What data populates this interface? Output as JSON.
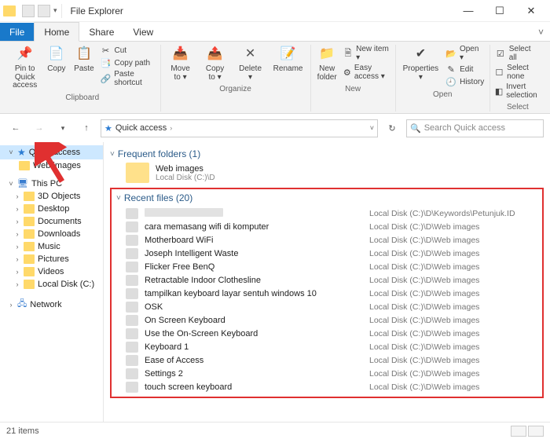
{
  "window": {
    "title": "File Explorer",
    "tabs": {
      "file": "File",
      "home": "Home",
      "share": "Share",
      "view": "View"
    }
  },
  "ribbon": {
    "pin": "Pin to Quick\naccess",
    "copy": "Copy",
    "paste": "Paste",
    "cut": "Cut",
    "copy_path": "Copy path",
    "paste_shortcut": "Paste shortcut",
    "group_clipboard": "Clipboard",
    "move_to": "Move\nto ▾",
    "copy_to": "Copy\nto ▾",
    "delete": "Delete\n▾",
    "rename": "Rename",
    "group_organize": "Organize",
    "new_folder": "New\nfolder",
    "new_item": "New item ▾",
    "easy_access": "Easy access ▾",
    "group_new": "New",
    "properties": "Properties\n▾",
    "open": "Open ▾",
    "edit": "Edit",
    "history": "History",
    "group_open": "Open",
    "select_all": "Select all",
    "select_none": "Select none",
    "invert_selection": "Invert selection",
    "group_select": "Select"
  },
  "address": {
    "crumb1": "Quick access",
    "search_placeholder": "Search Quick access"
  },
  "sidebar": {
    "quick_access": "Quick access",
    "web_images": "Web images",
    "this_pc": "This PC",
    "items": [
      "3D Objects",
      "Desktop",
      "Documents",
      "Downloads",
      "Music",
      "Pictures",
      "Videos",
      "Local Disk (C:)"
    ],
    "network": "Network"
  },
  "frequent": {
    "heading": "Frequent folders (1)",
    "item_name": "Web images",
    "item_path": "Local Disk (C:)\\D"
  },
  "recent": {
    "heading": "Recent files (20)",
    "files": [
      {
        "name": "",
        "blurred": true,
        "path": "Local Disk (C:)\\D\\Keywords\\Petunjuk.ID"
      },
      {
        "name": "cara memasang wifi di komputer",
        "path": "Local Disk (C:)\\D\\Web images"
      },
      {
        "name": "Motherboard WiFi",
        "path": "Local Disk (C:)\\D\\Web images"
      },
      {
        "name": "Joseph Intelligent Waste",
        "path": "Local Disk (C:)\\D\\Web images"
      },
      {
        "name": "Flicker Free BenQ",
        "path": "Local Disk (C:)\\D\\Web images"
      },
      {
        "name": "Retractable Indoor Clothesline",
        "path": "Local Disk (C:)\\D\\Web images"
      },
      {
        "name": "tampilkan keyboard layar sentuh windows 10",
        "path": "Local Disk (C:)\\D\\Web images"
      },
      {
        "name": "OSK",
        "path": "Local Disk (C:)\\D\\Web images"
      },
      {
        "name": "On Screen Keyboard",
        "path": "Local Disk (C:)\\D\\Web images"
      },
      {
        "name": "Use the On-Screen Keyboard",
        "path": "Local Disk (C:)\\D\\Web images"
      },
      {
        "name": "Keyboard 1",
        "path": "Local Disk (C:)\\D\\Web images"
      },
      {
        "name": "Ease of Access",
        "path": "Local Disk (C:)\\D\\Web images"
      },
      {
        "name": "Settings 2",
        "path": "Local Disk (C:)\\D\\Web images"
      },
      {
        "name": "touch screen keyboard",
        "path": "Local Disk (C:)\\D\\Web images"
      }
    ]
  },
  "status": {
    "text": "21 items"
  },
  "annotation": {
    "arrow_points_to": "Quick access sidebar entry"
  }
}
